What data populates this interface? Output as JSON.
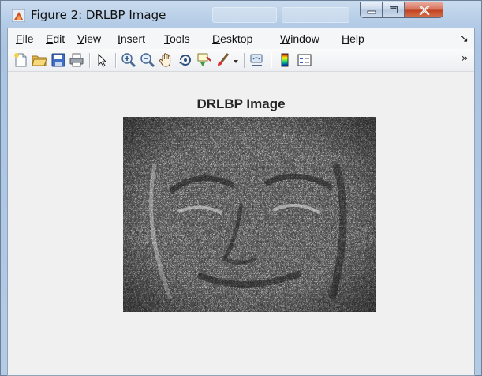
{
  "window": {
    "title": "Figure 2: DRLBP Image"
  },
  "menubar": {
    "items": [
      {
        "mnemonic": "F",
        "rest": "ile"
      },
      {
        "mnemonic": "E",
        "rest": "dit"
      },
      {
        "mnemonic": "V",
        "rest": "iew"
      },
      {
        "mnemonic": "I",
        "rest": "nsert"
      },
      {
        "mnemonic": "T",
        "rest": "ools"
      },
      {
        "mnemonic": "D",
        "rest": "esktop"
      },
      {
        "mnemonic": "W",
        "rest": "indow"
      },
      {
        "mnemonic": "H",
        "rest": "elp"
      }
    ],
    "pin_glyph": "↘"
  },
  "toolbar": {
    "overflow_glyph": "»",
    "icons": [
      "new-figure-icon",
      "open-file-icon",
      "save-icon",
      "print-icon",
      "edit-plot-arrow-icon",
      "zoom-in-icon",
      "zoom-out-icon",
      "pan-hand-icon",
      "rotate-3d-icon",
      "data-cursor-icon",
      "brush-icon",
      "brush-dropdown-icon",
      "link-plot-icon",
      "colorbar-icon",
      "legend-icon"
    ]
  },
  "figure": {
    "title": "DRLBP Image"
  },
  "colors": {
    "title_bar": "#b3cbe6",
    "close_button": "#c1401f",
    "figure_background": "#f0f0f0"
  }
}
